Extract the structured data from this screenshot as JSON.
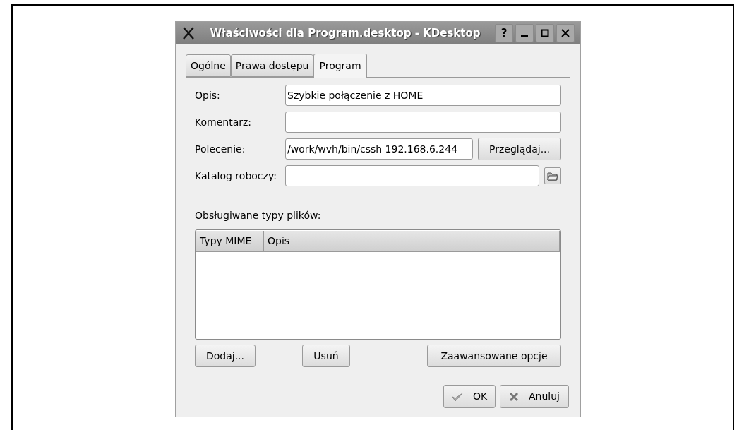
{
  "window": {
    "title": "Właściwości dla Program.desktop - KDesktop",
    "buttons": [
      {
        "kind": "help",
        "label": "?"
      },
      {
        "kind": "minimize"
      },
      {
        "kind": "maximize"
      },
      {
        "kind": "close"
      }
    ]
  },
  "tabs": [
    {
      "label": "Ogólne",
      "selected": false
    },
    {
      "label": "Prawa dostępu",
      "selected": false
    },
    {
      "label": "Program",
      "selected": true
    }
  ],
  "fields": [
    {
      "label": "Opis:",
      "value": "Szybkie połączenie z HOME"
    },
    {
      "label": "Komentarz:"
    },
    {
      "label": "Polecenie:",
      "value": "/work/wvh/bin/cssh 192.168.6.244",
      "button": {
        "kind": "browse",
        "label": "Przeglądaj..."
      }
    },
    {
      "label": "Katalog roboczy:",
      "button": {
        "kind": "folder"
      }
    }
  ],
  "file_types": {
    "label": "Obsługiwane typy plików:",
    "columns": [
      "Typy MIME",
      "Opis"
    ]
  },
  "list_buttons": [
    {
      "label": "Dodaj..."
    },
    {
      "label": "Usuń"
    },
    {
      "label": "Zaawansowane opcje"
    }
  ],
  "dialog_buttons": [
    {
      "kind": "ok",
      "label": "OK"
    },
    {
      "kind": "cancel",
      "label": "Anuluj"
    }
  ]
}
